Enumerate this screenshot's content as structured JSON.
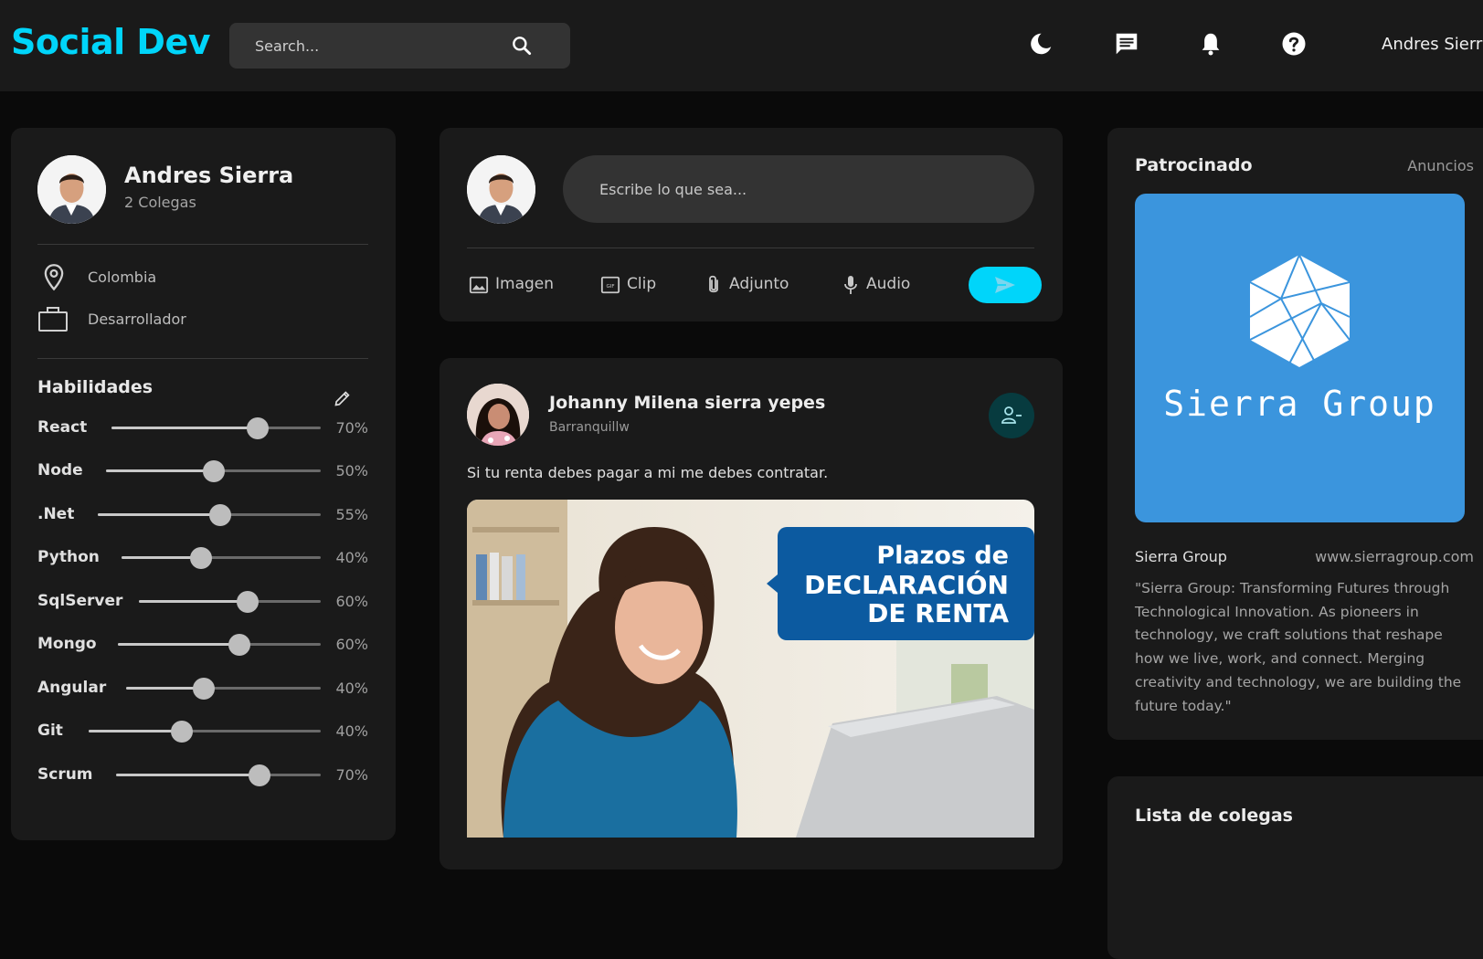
{
  "navbar": {
    "brand": "Social Dev",
    "search_placeholder": "Search...",
    "user_name": "Andres Sierra"
  },
  "profile": {
    "name": "Andres Sierra",
    "colleagues": "2 Colegas",
    "location": "Colombia",
    "occupation": "Desarrollador",
    "skills_title": "Habilidades",
    "skills": [
      {
        "name": "React",
        "percent": 70,
        "label": "70%"
      },
      {
        "name": "Node",
        "percent": 50,
        "label": "50%"
      },
      {
        "name": ".Net",
        "percent": 55,
        "label": "55%"
      },
      {
        "name": "Python",
        "percent": 40,
        "label": "40%"
      },
      {
        "name": "SqlServer",
        "percent": 60,
        "label": "60%"
      },
      {
        "name": "Mongo",
        "percent": 60,
        "label": "60%"
      },
      {
        "name": "Angular",
        "percent": 40,
        "label": "40%"
      },
      {
        "name": "Git",
        "percent": 40,
        "label": "40%"
      },
      {
        "name": "Scrum",
        "percent": 70,
        "label": "70%"
      }
    ]
  },
  "composer": {
    "placeholder": "Escribe lo que sea...",
    "actions": {
      "image": "Imagen",
      "clip": "Clip",
      "attachment": "Adjunto",
      "audio": "Audio"
    }
  },
  "post": {
    "author": "Johanny Milena sierra yepes",
    "location": "Barranquillw",
    "text": "Si tu renta debes pagar a mi me debes contratar.",
    "image_overlay": {
      "line1": "Plazos de",
      "line2": "DECLARACIÓN",
      "line3": "DE RENTA"
    }
  },
  "sponsored": {
    "title": "Patrocinado",
    "ads_label": "Anuncios",
    "banner_text": "Sierra Group",
    "company": "Sierra Group",
    "url": "www.sierragroup.com",
    "description": "\"Sierra Group: Transforming Futures through Technological Innovation. As pioneers in technology, we craft solutions that reshape how we live, work, and connect. Merging creativity and technology, we are building the future today.\""
  },
  "friends": {
    "title": "Lista de colegas"
  },
  "colors": {
    "accent": "#00d5fa",
    "background": "#0a0a0a",
    "card": "#1a1a1a",
    "sponsor_blue": "#3b95dd"
  },
  "icons": {
    "theme": "moon-icon",
    "messages": "chat-icon",
    "notifications": "bell-icon",
    "help": "help-icon",
    "search": "search-icon"
  }
}
